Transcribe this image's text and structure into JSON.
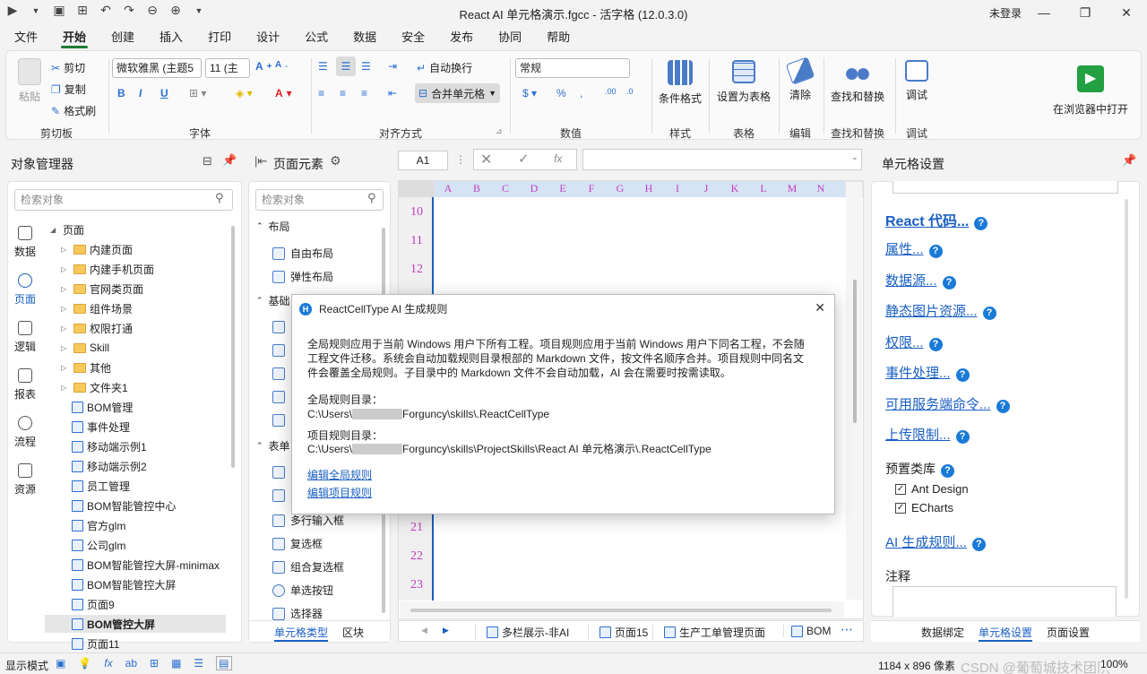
{
  "window": {
    "title": "React AI 单元格演示.fgcc - 活字格 (12.0.3.0)",
    "login": "未登录"
  },
  "menu": [
    "文件",
    "开始",
    "创建",
    "插入",
    "打印",
    "设计",
    "公式",
    "数据",
    "安全",
    "发布",
    "协同",
    "帮助"
  ],
  "ribbon": {
    "clipboard": {
      "paste": "粘贴",
      "cut": "剪切",
      "copy": "复制",
      "format_painter": "格式刷",
      "label": "剪切板"
    },
    "font": {
      "family": "微软雅黑 (主题5",
      "size": "11 (主",
      "label": "字体"
    },
    "align": {
      "wrap": "自动换行",
      "merge": "合并单元格",
      "label": "对齐方式"
    },
    "number": {
      "format": "常规",
      "label": "数值"
    },
    "style": {
      "btn": "条件格式",
      "label": "样式"
    },
    "table": {
      "btn": "设置为表格",
      "label": "表格"
    },
    "edit": {
      "btn": "清除",
      "label": "编辑"
    },
    "find": {
      "btn": "查找和替换",
      "label": "查找和替换"
    },
    "debug": {
      "btn": "调试",
      "label": "调试"
    },
    "run": {
      "btn": "在浏览器中打开"
    }
  },
  "object_manager": {
    "title": "对象管理器",
    "search_placeholder": "检索对象",
    "nav": [
      "数据",
      "页面",
      "逻辑",
      "报表",
      "流程",
      "资源"
    ],
    "root": "页面",
    "folders": [
      "内建页面",
      "内建手机页面",
      "官网类页面",
      "组件场景",
      "权限打通",
      "Skill",
      "其他",
      "文件夹1"
    ],
    "pages": [
      "BOM管理",
      "事件处理",
      "移动端示例1",
      "移动端示例2",
      "员工管理",
      "BOM智能管控中心",
      "官方glm",
      "公司glm",
      "BOM智能管控大屏-minimax",
      "BOM智能管控大屏",
      "页面9",
      "BOM管控大屏",
      "页面11"
    ]
  },
  "page_elements": {
    "title": "页面元素",
    "search_placeholder": "检索对象",
    "layout_section": "布局",
    "layout_items": [
      "自由布局",
      "弹性布局"
    ],
    "basic_section": "基础",
    "form_section": "表单",
    "form_items": [
      "多行输入框",
      "复选框",
      "组合复选框",
      "单选按钮",
      "选择器"
    ],
    "tabs": [
      "单元格类型",
      "区块"
    ]
  },
  "formula_bar": {
    "cell": "A1",
    "fx": "fx"
  },
  "grid": {
    "columns": [
      "A",
      "B",
      "C",
      "D",
      "E",
      "F",
      "G",
      "H",
      "I",
      "J",
      "K",
      "L",
      "M",
      "N"
    ],
    "rows_top": [
      "10",
      "11",
      "12"
    ],
    "rows_bottom": [
      "21",
      "22",
      "23"
    ]
  },
  "sheet_tabs": [
    "多栏展示-非AI",
    "页面15",
    "生产工单管理页面",
    "BOM"
  ],
  "dialog": {
    "title": "ReactCellType AI 生成规则",
    "desc1": "全局规则应用于当前 Windows 用户下所有工程。项目规则应用于当前 Windows 用户下同名工程，不会随",
    "desc2": "工程文件迁移。系统会自动加载规则目录根部的 Markdown 文件，按文件名顺序合并。项目规则中同名文",
    "desc3": "件会覆盖全局规则。子目录中的 Markdown 文件不会自动加载，AI 会在需要时按需读取。",
    "global_label": "全局规则目录：",
    "global_path_a": "C:\\Users\\",
    "global_path_b": "Forguncy\\skills\\.ReactCellType",
    "project_label": "项目规则目录：",
    "project_path_a": "C:\\Users\\",
    "project_path_b": "Forguncy\\skills\\ProjectSkills\\React AI 单元格演示\\.ReactCellType",
    "edit_global": "编辑全局规则",
    "edit_project": "编辑项目规则"
  },
  "cell_settings": {
    "title": "单元格设置",
    "links": [
      "React 代码...",
      "属性...",
      "数据源...",
      "静态图片资源...",
      "权限...",
      "事件处理...",
      "可用服务端命令...",
      "上传限制..."
    ],
    "preset_label": "预置类库",
    "presets": [
      "Ant Design",
      "ECharts"
    ],
    "ai_rules": "AI 生成规则...",
    "comment_label": "注释",
    "tabs": [
      "数据绑定",
      "单元格设置",
      "页面设置"
    ]
  },
  "status": {
    "mode": "显示模式",
    "resolution": "1184 x 896 像素",
    "zoom": "100%",
    "watermark": "CSDN @葡萄城技术团队"
  },
  "colors": {
    "accent": "#1e7b34",
    "link": "#1a5fc2",
    "header": "#c040c0"
  }
}
